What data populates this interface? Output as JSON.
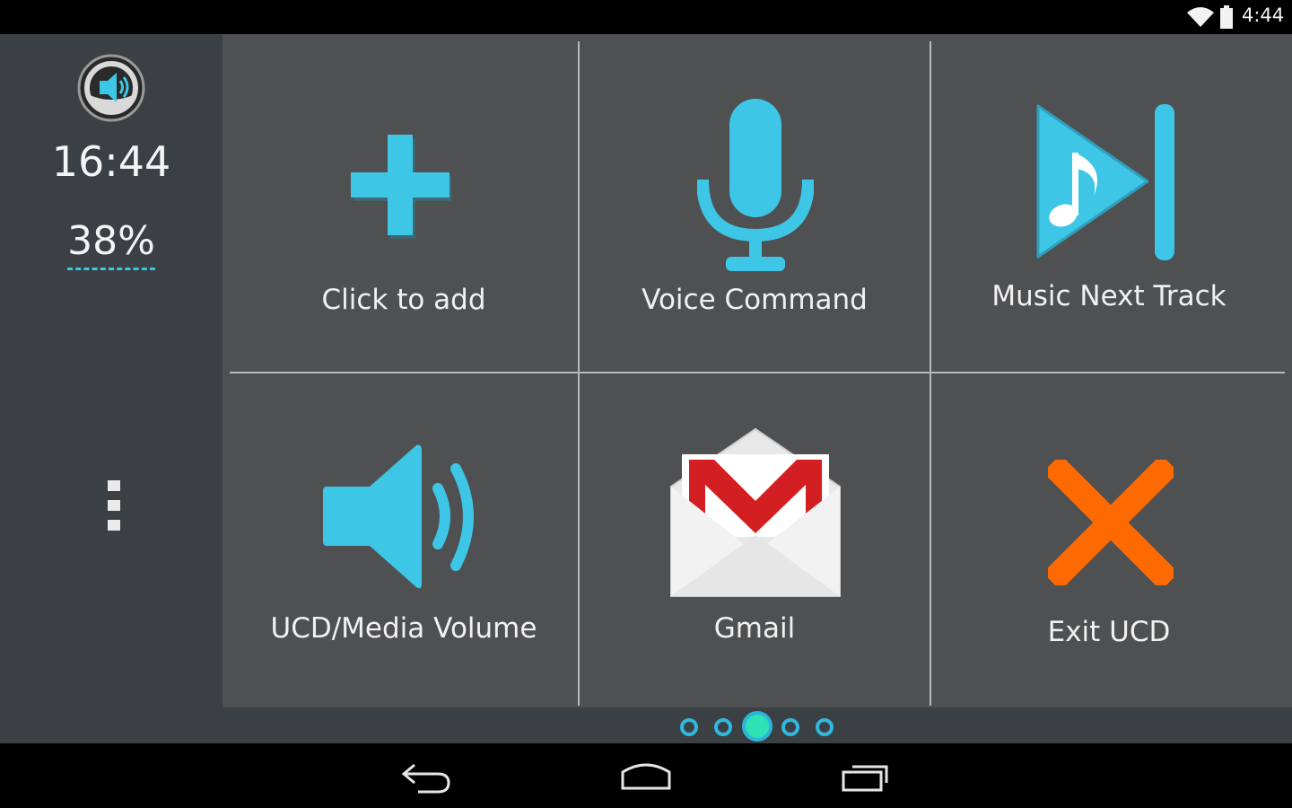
{
  "status_bar": {
    "clock": "4:44",
    "icons": [
      "wifi-icon",
      "battery-icon"
    ]
  },
  "sidebar": {
    "logo_icon": "speaker-steering-wheel-icon",
    "time": "16:44",
    "battery_percent": "38%",
    "menu_icon": "overflow-menu-icon"
  },
  "tiles": [
    {
      "label": "Click to add",
      "icon": "plus-icon"
    },
    {
      "label": "Voice Command",
      "icon": "microphone-icon"
    },
    {
      "label": "Music Next Track",
      "icon": "music-next-track-icon"
    },
    {
      "label": "UCD/Media Volume",
      "icon": "volume-icon"
    },
    {
      "label": "Gmail",
      "icon": "gmail-icon"
    },
    {
      "label": "Exit UCD",
      "icon": "close-x-icon"
    }
  ],
  "pager": {
    "page_count": 5,
    "active_page": 3
  },
  "nav_bar": {
    "icons": [
      "back-icon",
      "home-icon",
      "recent-apps-icon"
    ]
  },
  "colors": {
    "accent": "#3ec6e6",
    "exit": "#ff6a00",
    "gmail_red": "#d41f22",
    "tile_bg": "#4f5052",
    "sidebar_bg": "#3b4044"
  }
}
